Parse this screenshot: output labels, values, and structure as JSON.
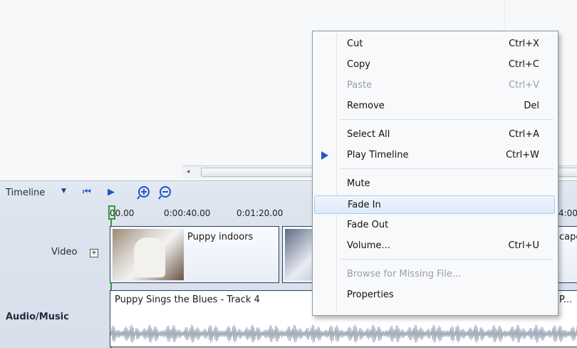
{
  "timeline": {
    "title": "Timeline",
    "ruler": [
      "00.00",
      "0:00:40.00",
      "0:01:20.00",
      "4:00"
    ],
    "tracks": {
      "video_label": "Video",
      "audio_label": "Audio/Music",
      "expand_glyph": "+"
    }
  },
  "video_clips": [
    {
      "title": "Puppy indoors"
    },
    {
      "title": ""
    },
    {
      "title": "cape"
    }
  ],
  "audio_clips": [
    {
      "title": "Puppy Sings the Blues - Track 4"
    },
    {
      "title": "P..."
    }
  ],
  "context_menu": {
    "items": [
      {
        "label": "Cut",
        "shortcut": "Ctrl+X"
      },
      {
        "label": "Copy",
        "shortcut": "Ctrl+C"
      },
      {
        "label": "Paste",
        "shortcut": "Ctrl+V",
        "disabled": true
      },
      {
        "label": "Remove",
        "shortcut": "Del"
      },
      {
        "label": "Select All",
        "shortcut": "Ctrl+A"
      },
      {
        "label": "Play Timeline",
        "shortcut": "Ctrl+W",
        "icon": "play-icon"
      },
      {
        "label": "Mute",
        "shortcut": ""
      },
      {
        "label": "Fade In",
        "shortcut": "",
        "highlighted": true
      },
      {
        "label": "Fade Out",
        "shortcut": ""
      },
      {
        "label": "Volume...",
        "shortcut": "Ctrl+U"
      },
      {
        "label": "Browse for Missing File...",
        "shortcut": "",
        "disabled": true
      },
      {
        "label": "Properties",
        "shortcut": ""
      }
    ]
  },
  "icons": {
    "timeline_dropdown": "chevron-down-icon",
    "rewind": "skip-back-icon",
    "play": "play-icon",
    "zoom_in": "zoom-in-icon",
    "zoom_out": "zoom-out-icon",
    "scroll_left": "scroll-left-icon"
  },
  "colors": {
    "accent": "#1d57c5",
    "playhead": "#2f9a2f",
    "highlight": "#dcebf9"
  }
}
